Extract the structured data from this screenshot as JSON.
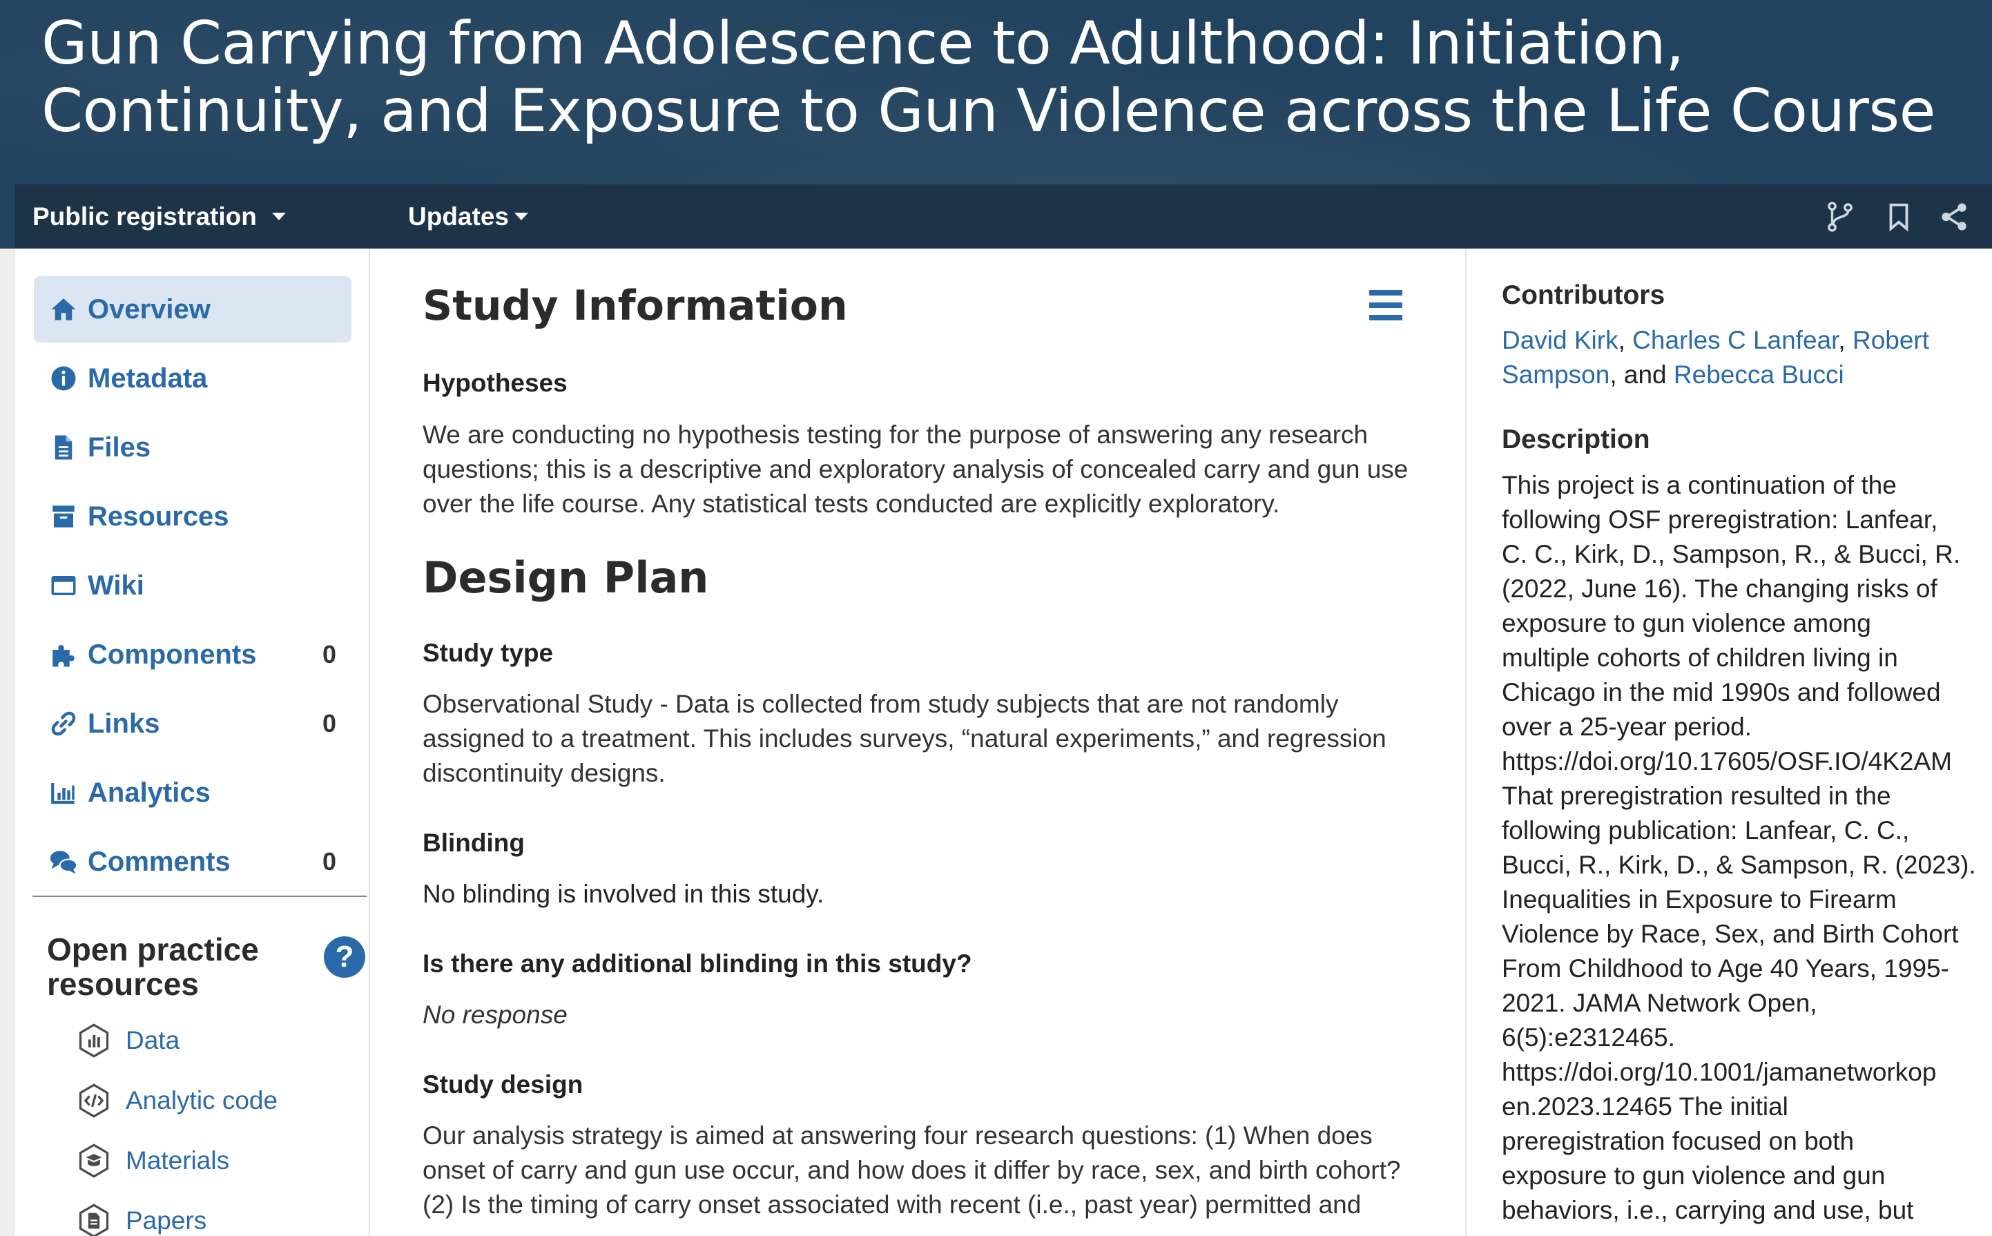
{
  "header": {
    "title_line1": "Gun Carrying from Adolescence to Adulthood: Initiation,",
    "title_line2": "Continuity, and Exposure to Gun Violence across the Life Course"
  },
  "navbar": {
    "registration_menu": "Public registration",
    "updates_menu": "Updates",
    "icons": [
      "fork-icon",
      "bookmark-icon",
      "share-icon"
    ]
  },
  "sidebar": {
    "items": [
      {
        "label": "Overview",
        "icon": "home-icon",
        "active": true
      },
      {
        "label": "Metadata",
        "icon": "info-icon"
      },
      {
        "label": "Files",
        "icon": "file-icon"
      },
      {
        "label": "Resources",
        "icon": "archive-icon"
      },
      {
        "label": "Wiki",
        "icon": "wiki-icon"
      },
      {
        "label": "Components",
        "icon": "puzzle-icon",
        "count": "0"
      },
      {
        "label": "Links",
        "icon": "link-icon",
        "count": "0"
      },
      {
        "label": "Analytics",
        "icon": "bar-chart-icon"
      },
      {
        "label": "Comments",
        "icon": "comments-icon",
        "count": "0"
      }
    ],
    "open_practice": {
      "title_line1": "Open practice",
      "title_line2": "resources",
      "help": "?",
      "resources": [
        {
          "label": "Data",
          "icon": "data-badge-icon"
        },
        {
          "label": "Analytic code",
          "icon": "code-badge-icon"
        },
        {
          "label": "Materials",
          "icon": "materials-badge-icon"
        },
        {
          "label": "Papers",
          "icon": "papers-badge-icon"
        }
      ]
    }
  },
  "main": {
    "study_information": "Study Information",
    "hypotheses": {
      "label": "Hypotheses",
      "lines": [
        "We are conducting no hypothesis testing for the purpose of answering any research",
        "questions; this is a descriptive and exploratory analysis of concealed carry and gun use",
        "over the life course. Any statistical tests conducted are explicitly exploratory."
      ]
    },
    "design_plan": "Design Plan",
    "study_type": {
      "label": "Study type",
      "lines": [
        "Observational Study - Data is collected from study subjects that are not randomly",
        "assigned to a treatment. This includes surveys, “natural experiments,” and regression",
        "discontinuity designs."
      ]
    },
    "blinding": {
      "label": "Blinding",
      "text": "No blinding is involved in this study."
    },
    "additional_blinding": {
      "label": "Is there any additional blinding in this study?",
      "text": "No response"
    },
    "study_design": {
      "label": "Study design",
      "lines": [
        "Our analysis strategy is aimed at answering four research questions: (1) When does",
        "onset of carry and gun use occur, and how does it differ by race, sex, and birth cohort?",
        "(2) Is the timing of carry onset associated with recent (i.e., past year) permitted and"
      ]
    }
  },
  "right": {
    "contributors_heading": "Contributors",
    "contributors": [
      "David Kirk",
      "Charles C Lanfear",
      "Robert",
      "Sampson",
      "Rebecca Bucci"
    ],
    "contributors_sep1": ", ",
    "contributors_sep2": ", ",
    "contributors_and": ", and ",
    "description_heading": "Description",
    "description_lines": [
      "This project is a continuation of the",
      "following OSF preregistration: Lanfear,",
      "C. C., Kirk, D., Sampson, R., & Bucci, R.",
      "(2022, June 16). The changing risks of",
      "exposure to gun violence among",
      "multiple cohorts of children living in",
      "Chicago in the mid 1990s and followed",
      "over a 25-year period.",
      "https://doi.org/10.17605/OSF.IO/4K2AM",
      "That preregistration resulted in the",
      "following publication: Lanfear, C. C.,",
      "Bucci, R., Kirk, D., & Sampson, R. (2023).",
      "Inequalities in Exposure to Firearm",
      "Violence by Race, Sex, and Birth Cohort",
      "From Childhood to Age 40 Years, 1995-",
      "2021. JAMA Network Open,",
      "6(5):e2312465.",
      "https://doi.org/10.1001/jamanetworkop",
      "en.2023.12465 The initial",
      "preregistration focused on both",
      "exposure to gun violence and gun",
      "behaviors, i.e., carrying and use, but"
    ]
  },
  "colors": {
    "banner": "#22435f",
    "navbar": "#1d3347",
    "link": "#2b6aa8",
    "active_bg": "#dbe6f2"
  }
}
